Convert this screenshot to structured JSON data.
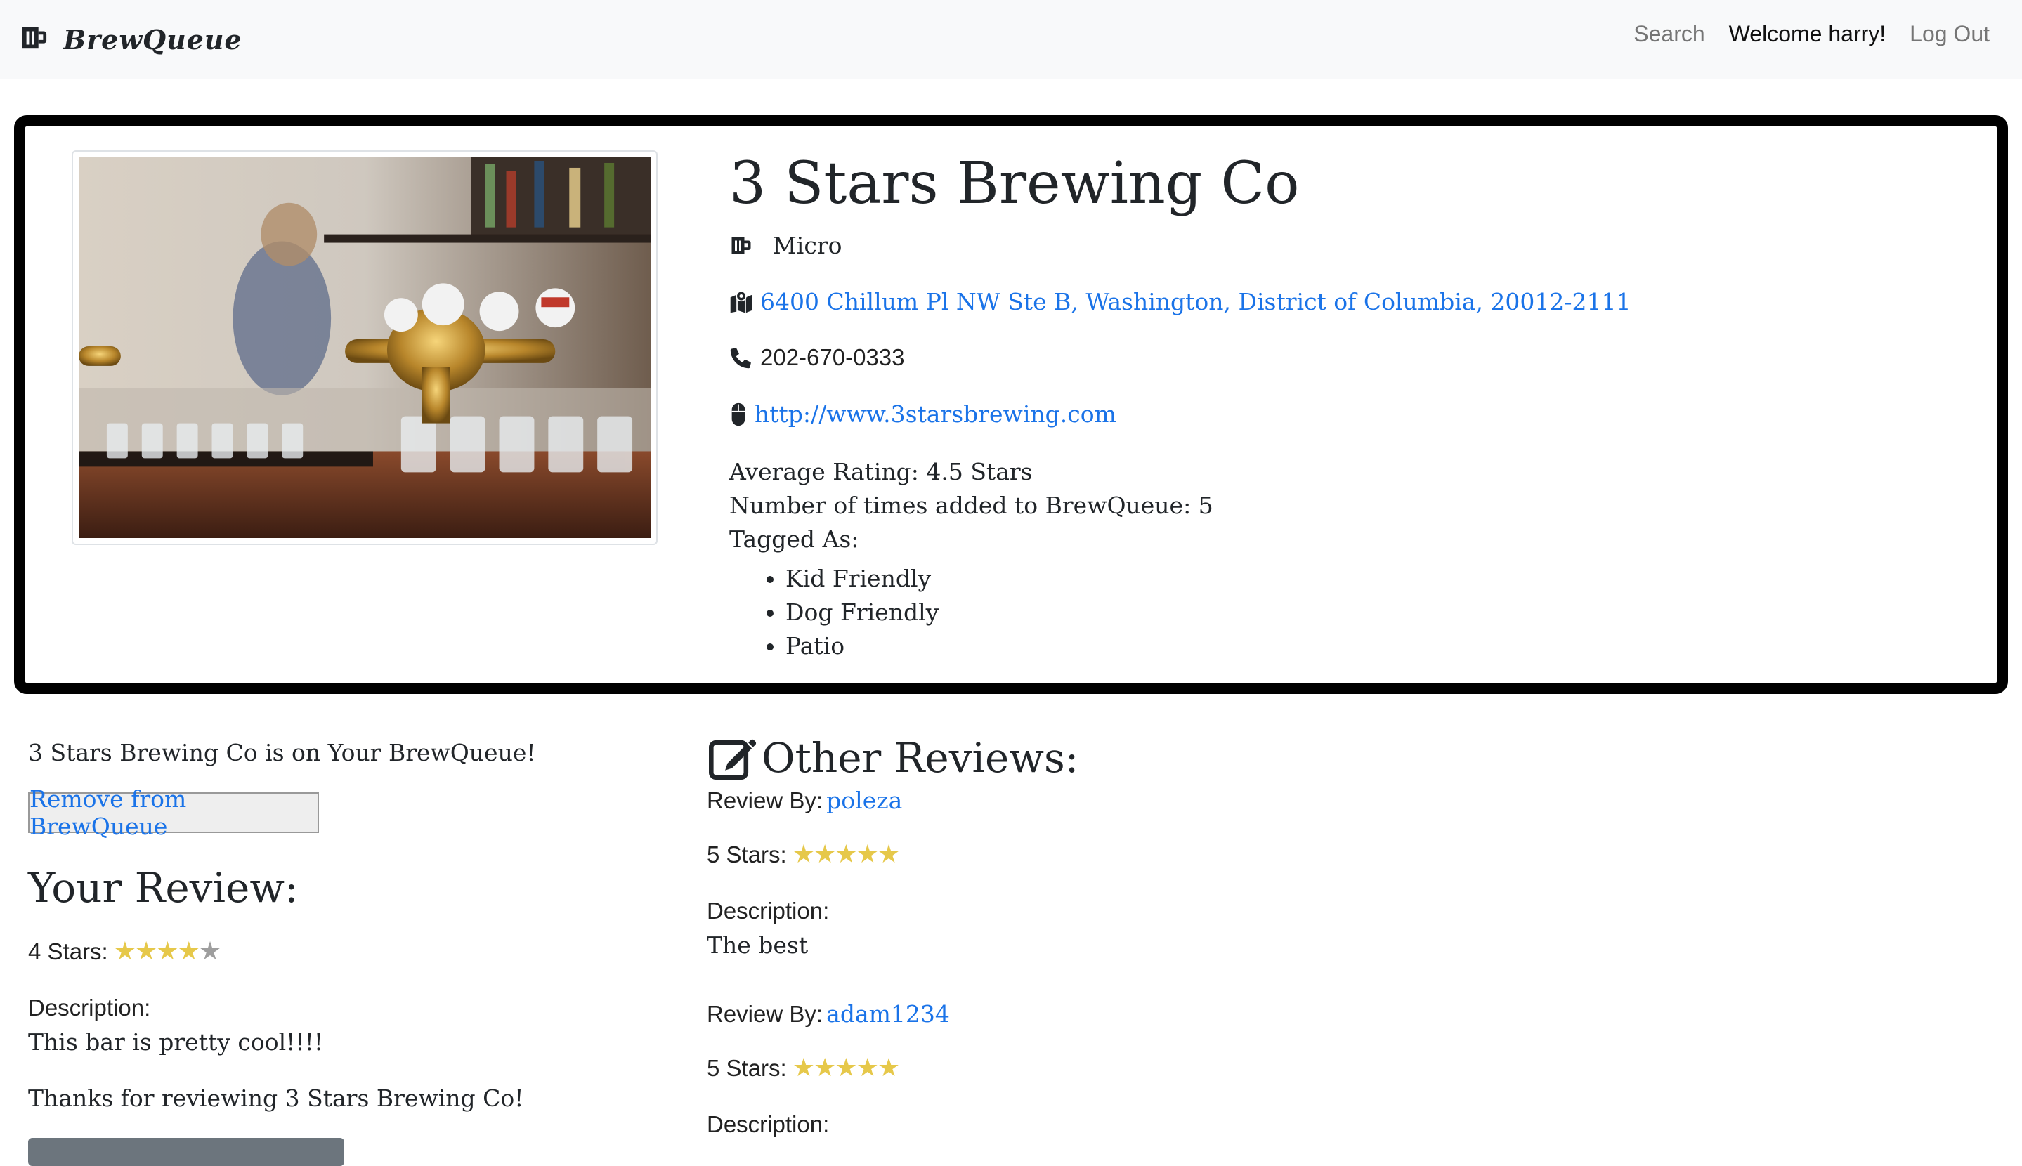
{
  "nav": {
    "brand": "BrewQueue",
    "search": "Search",
    "welcome": "Welcome harry!",
    "logout": "Log Out",
    "brand_icon": "beer-mug-icon"
  },
  "brewery": {
    "name": "3 Stars Brewing Co",
    "type": "Micro",
    "address": "6400 Chillum Pl NW Ste B, Washington, District of Columbia, 20012-2111",
    "phone": "202-670-0333",
    "website": "http://www.3starsbrewing.com",
    "avg_rating_label": "Average Rating:",
    "avg_rating_value": "4.5 Stars",
    "added_label": "Number of times added to BrewQueue:",
    "added_value": "5",
    "tagged_label": "Tagged As:",
    "tags": [
      "Kid Friendly",
      "Dog Friendly",
      "Patio"
    ]
  },
  "queue": {
    "status": "3 Stars Brewing Co is on Your BrewQueue!",
    "remove_label": "Remove from BrewQueue"
  },
  "your_review": {
    "heading": "Your Review:",
    "stars_label": "4 Stars:",
    "rating": 4,
    "description_label": "Description:",
    "description": "This bar is pretty cool!!!!",
    "thanks": "Thanks for reviewing 3 Stars Brewing Co!"
  },
  "other_reviews": {
    "heading": "Other Reviews:",
    "items": [
      {
        "by_label": "Review By:",
        "user": "poleza",
        "stars_label": "5 Stars:",
        "rating": 5,
        "description_label": "Description:",
        "description": "The best"
      },
      {
        "by_label": "Review By:",
        "user": "adam1234",
        "stars_label": "5 Stars:",
        "rating": 5,
        "description_label": "Description:",
        "description": ""
      }
    ]
  },
  "colors": {
    "link": "#1a73e8",
    "star_filled": "#e6c84a",
    "star_empty": "#9e9e9e",
    "navbar_bg": "#f8f9fa"
  }
}
